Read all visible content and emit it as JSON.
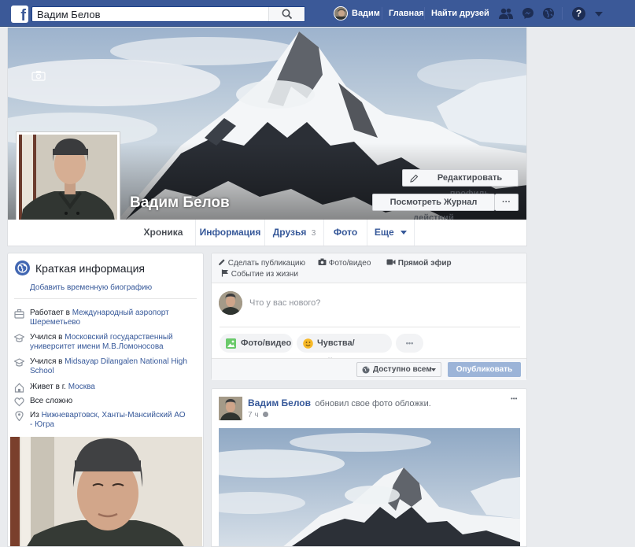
{
  "topbar": {
    "logo_letter": "f",
    "search_value": "Вадим Белов",
    "user_name": "Вадим",
    "home_label": "Главная",
    "find_friends_label": "Найти друзей",
    "help_glyph": "?"
  },
  "profile": {
    "name": "Вадим Белов",
    "edit_profile_label": "Редактировать профиль",
    "activity_log_label": "Посмотреть Журнал действий",
    "more_glyph": "···"
  },
  "tabs": {
    "timeline": "Хроника",
    "about": "Информация",
    "friends": "Друзья",
    "friends_count": "3",
    "photos": "Фото",
    "more": "Еще"
  },
  "intro": {
    "title": "Краткая информация",
    "add_bio": "Добавить временную биографию",
    "work_prefix": "Работает в ",
    "work_place": "Международный аэропорт Шереметьево",
    "edu1_prefix": "Учился в ",
    "edu1_place": "Московский государственный университет имени М.В.Ломоносова",
    "edu2_prefix": "Учился в ",
    "edu2_place": "Midsayap Dilangalen National High School",
    "lives_prefix": "Живет в г. ",
    "lives_place": "Москва",
    "relationship": "Все сложно",
    "from_prefix": "Из ",
    "from_place": "Нижневартовск, Ханты-Мансийский АО - Югра"
  },
  "composer": {
    "create_post": "Сделать публикацию",
    "photo_video": "Фото/видео",
    "live": "Прямой эфир",
    "life_event": "Событие из жизни",
    "placeholder": "Что у вас нового?",
    "pill_photo": "Фото/видео",
    "pill_feeling": "Чувства/действия",
    "pill_more": "•••",
    "audience": "Доступно всем",
    "publish": "Опубликовать"
  },
  "post": {
    "author": "Вадим Белов",
    "action": "обновил свое фото обложки.",
    "time": "7 ч",
    "menu": "•••"
  },
  "colors": {
    "brand": "#3b5998",
    "link": "#365899",
    "page_bg": "#e9ebee",
    "publish_disabled": "#9cb4d8"
  }
}
